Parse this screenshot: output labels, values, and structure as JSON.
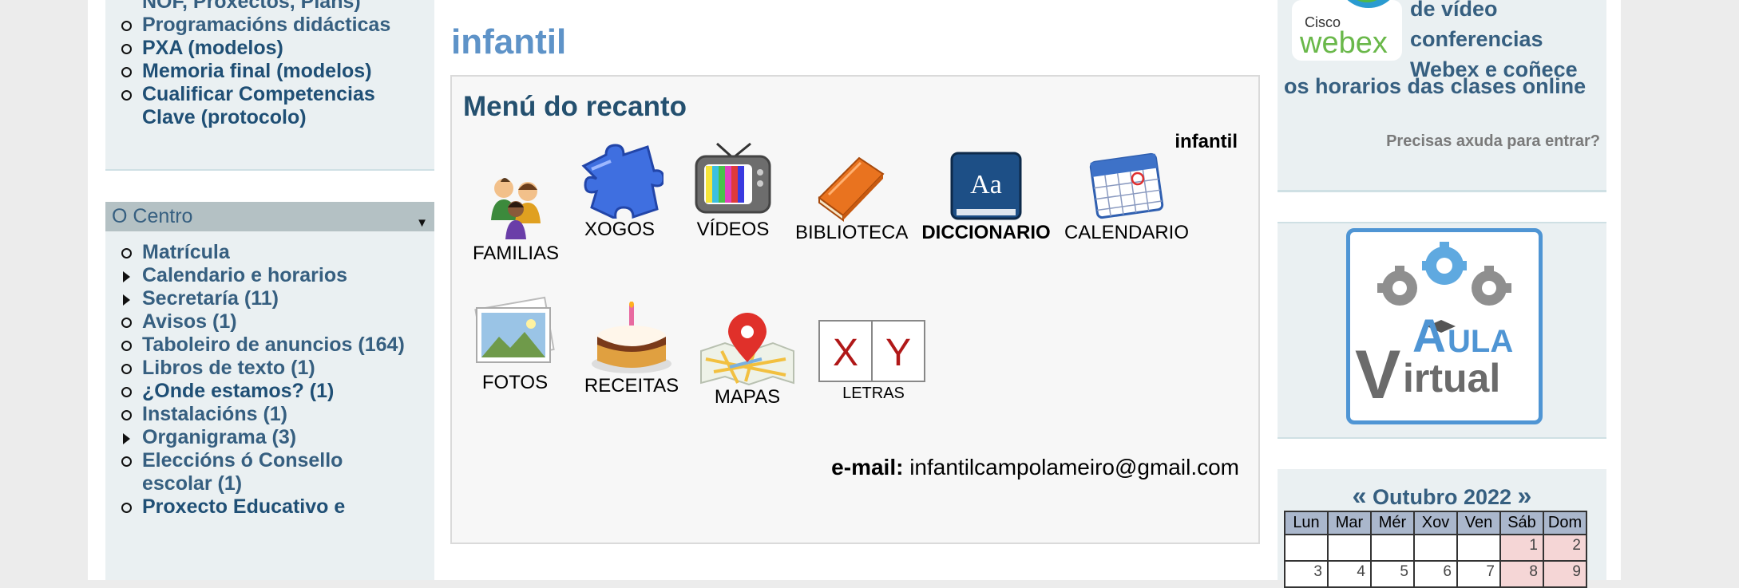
{
  "left_top": {
    "items": [
      {
        "label": "NOF, Proxectos, Plans)",
        "marker": "none"
      },
      {
        "label": "Programacións didácticas",
        "marker": "bullet"
      },
      {
        "label": "PXA (modelos)",
        "marker": "bullet",
        "dark": true
      },
      {
        "label": "Memoria final (modelos)",
        "marker": "bullet",
        "dark": true
      },
      {
        "label": "Cualificar Competencias",
        "marker": "bullet",
        "dark": true
      },
      {
        "label": "Clave (protocolo)",
        "marker": "none",
        "dark": true
      }
    ]
  },
  "centro": {
    "header": "O Centro",
    "items": [
      {
        "label": "Matrícula",
        "marker": "bullet"
      },
      {
        "label": "Calendario e horarios",
        "marker": "arrow"
      },
      {
        "label": "Secretaría (11)",
        "marker": "arrow"
      },
      {
        "label": "Avisos (1)",
        "marker": "bullet"
      },
      {
        "label": "Taboleiro de anuncios (164)",
        "marker": "bullet"
      },
      {
        "label": "Libros de texto (1)",
        "marker": "bullet"
      },
      {
        "label": "¿Onde estamos? (1)",
        "marker": "bullet",
        "dark": true
      },
      {
        "label": "Instalacións (1)",
        "marker": "bullet"
      },
      {
        "label": "Organigrama (3)",
        "marker": "arrow"
      },
      {
        "label": "Eleccións ó Consello",
        "marker": "bullet"
      },
      {
        "label": "escolar (1)",
        "marker": "none"
      },
      {
        "label": "Proxecto Educativo e",
        "marker": "bullet",
        "dark": true
      }
    ]
  },
  "main": {
    "title": "infantil",
    "panel_title": "Menú do recanto",
    "panel_subtitle": "infantil",
    "tiles": [
      {
        "label": "FAMILIAS",
        "icon": "family-icon"
      },
      {
        "label": "XOGOS",
        "icon": "puzzle-icon"
      },
      {
        "label": "VÍDEOS",
        "icon": "tv-icon"
      },
      {
        "label": "BIBLIOTECA",
        "icon": "book-icon"
      },
      {
        "label": "DICCIONARIO",
        "icon": "dictionary-icon",
        "badge": "Aa"
      },
      {
        "label": "CALENDARIO",
        "icon": "calendar-icon"
      },
      {
        "label": "FOTOS",
        "icon": "photos-icon"
      },
      {
        "label": "RECEITAS",
        "icon": "cake-icon"
      },
      {
        "label": "MAPAS",
        "icon": "map-pin-icon"
      },
      {
        "label": "LETRAS",
        "icon": "letters-icon",
        "letters": [
          "X",
          "Y"
        ]
      }
    ],
    "email_label": "e-mail:",
    "email_value": "infantilcampolameiro@gmail.com"
  },
  "right": {
    "webex_small": "Cisco",
    "webex_brand": "webex",
    "webex_lines": [
      "de vídeo",
      "conferencias",
      "Webex e coñece"
    ],
    "webex_line_last": "os horarios das clases online",
    "help": "Precisas axuda para entrar?",
    "aula": {
      "big_a": "A",
      "rest_a": "ULA",
      "big_v": "V",
      "rest_v": "irtual"
    }
  },
  "calendar": {
    "prev": "«",
    "next": "»",
    "month": "Outubro 2022",
    "days": [
      "Lun",
      "Mar",
      "Mér",
      "Xov",
      "Ven",
      "Sáb",
      "Dom"
    ],
    "week1": [
      "",
      "",
      "",
      "",
      "",
      "1",
      "2"
    ],
    "week2": [
      "3",
      "4",
      "5",
      "6",
      "7",
      "8",
      "9"
    ]
  },
  "colors": {
    "link": "#365f80",
    "heading": "#5e93c8",
    "sidebar_bg": "#eaf0f2",
    "section_head_bg": "#b4c1c4",
    "aula_blue": "#4f95d4"
  }
}
